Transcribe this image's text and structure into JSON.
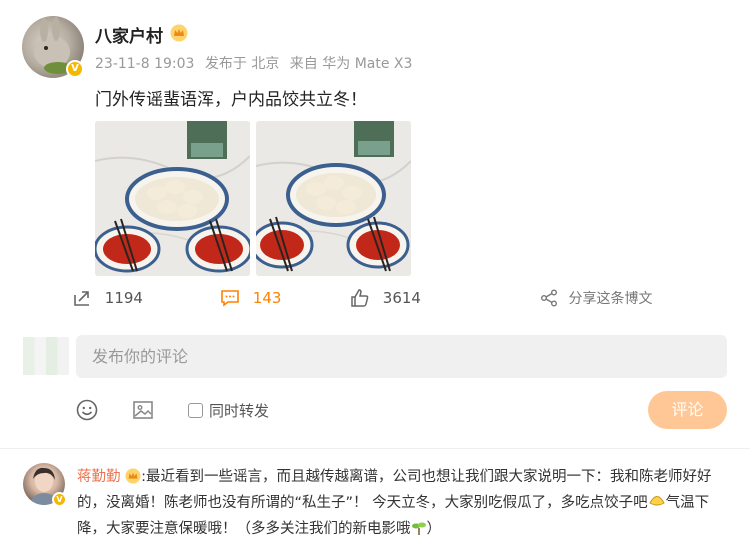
{
  "post": {
    "author": "八家户村",
    "timestamp": "23-11-8 19:03",
    "location": "发布于 北京",
    "device": "来自 华为 Mate X3",
    "content": "门外传谣蜚语浑，户内品饺共立冬！",
    "icons": {
      "vip": "crown-icon",
      "verified": "verified-v-icon"
    }
  },
  "actions": {
    "share_count": "1194",
    "comment_count": "143",
    "like_count": "3614",
    "repost_label": "分享这条博文",
    "active_color": "#ff8200"
  },
  "composer": {
    "placeholder": "发布你的评论",
    "forward_label": "同时转发",
    "submit_label": "评论",
    "submit_color": "#ffc796"
  },
  "comment": {
    "author": "蒋勤勤",
    "text": ":最近看到一些谣言，而且越传越离谱，公司也想让我们跟大家说明一下：我和陈老师好好的，没离婚！陈老师也没有所谓的“私生子”！ 今天立冬，大家别吃假瓜了，多吃点饺子吧",
    "text_tail": "气温下降，大家要注意保暖哦！（多多关注我们的新电影哦",
    "text_end": "）",
    "name_color": "#eb7350"
  }
}
